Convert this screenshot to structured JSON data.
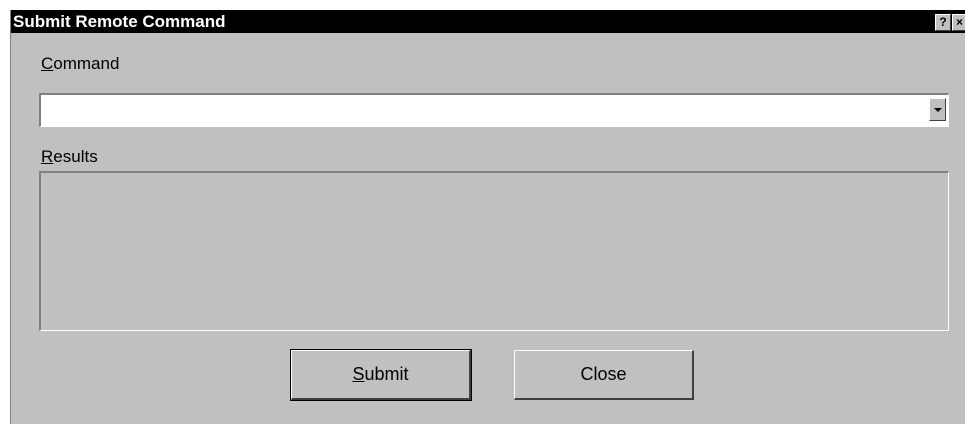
{
  "window": {
    "title": "Submit Remote Command",
    "help_label": "?",
    "close_label": "×"
  },
  "command": {
    "label_accel": "C",
    "label_rest": "ommand",
    "value": ""
  },
  "results": {
    "label_accel": "R",
    "label_rest": "esults",
    "value": ""
  },
  "buttons": {
    "submit_accel": "S",
    "submit_rest": "ubmit",
    "close": "Close"
  }
}
